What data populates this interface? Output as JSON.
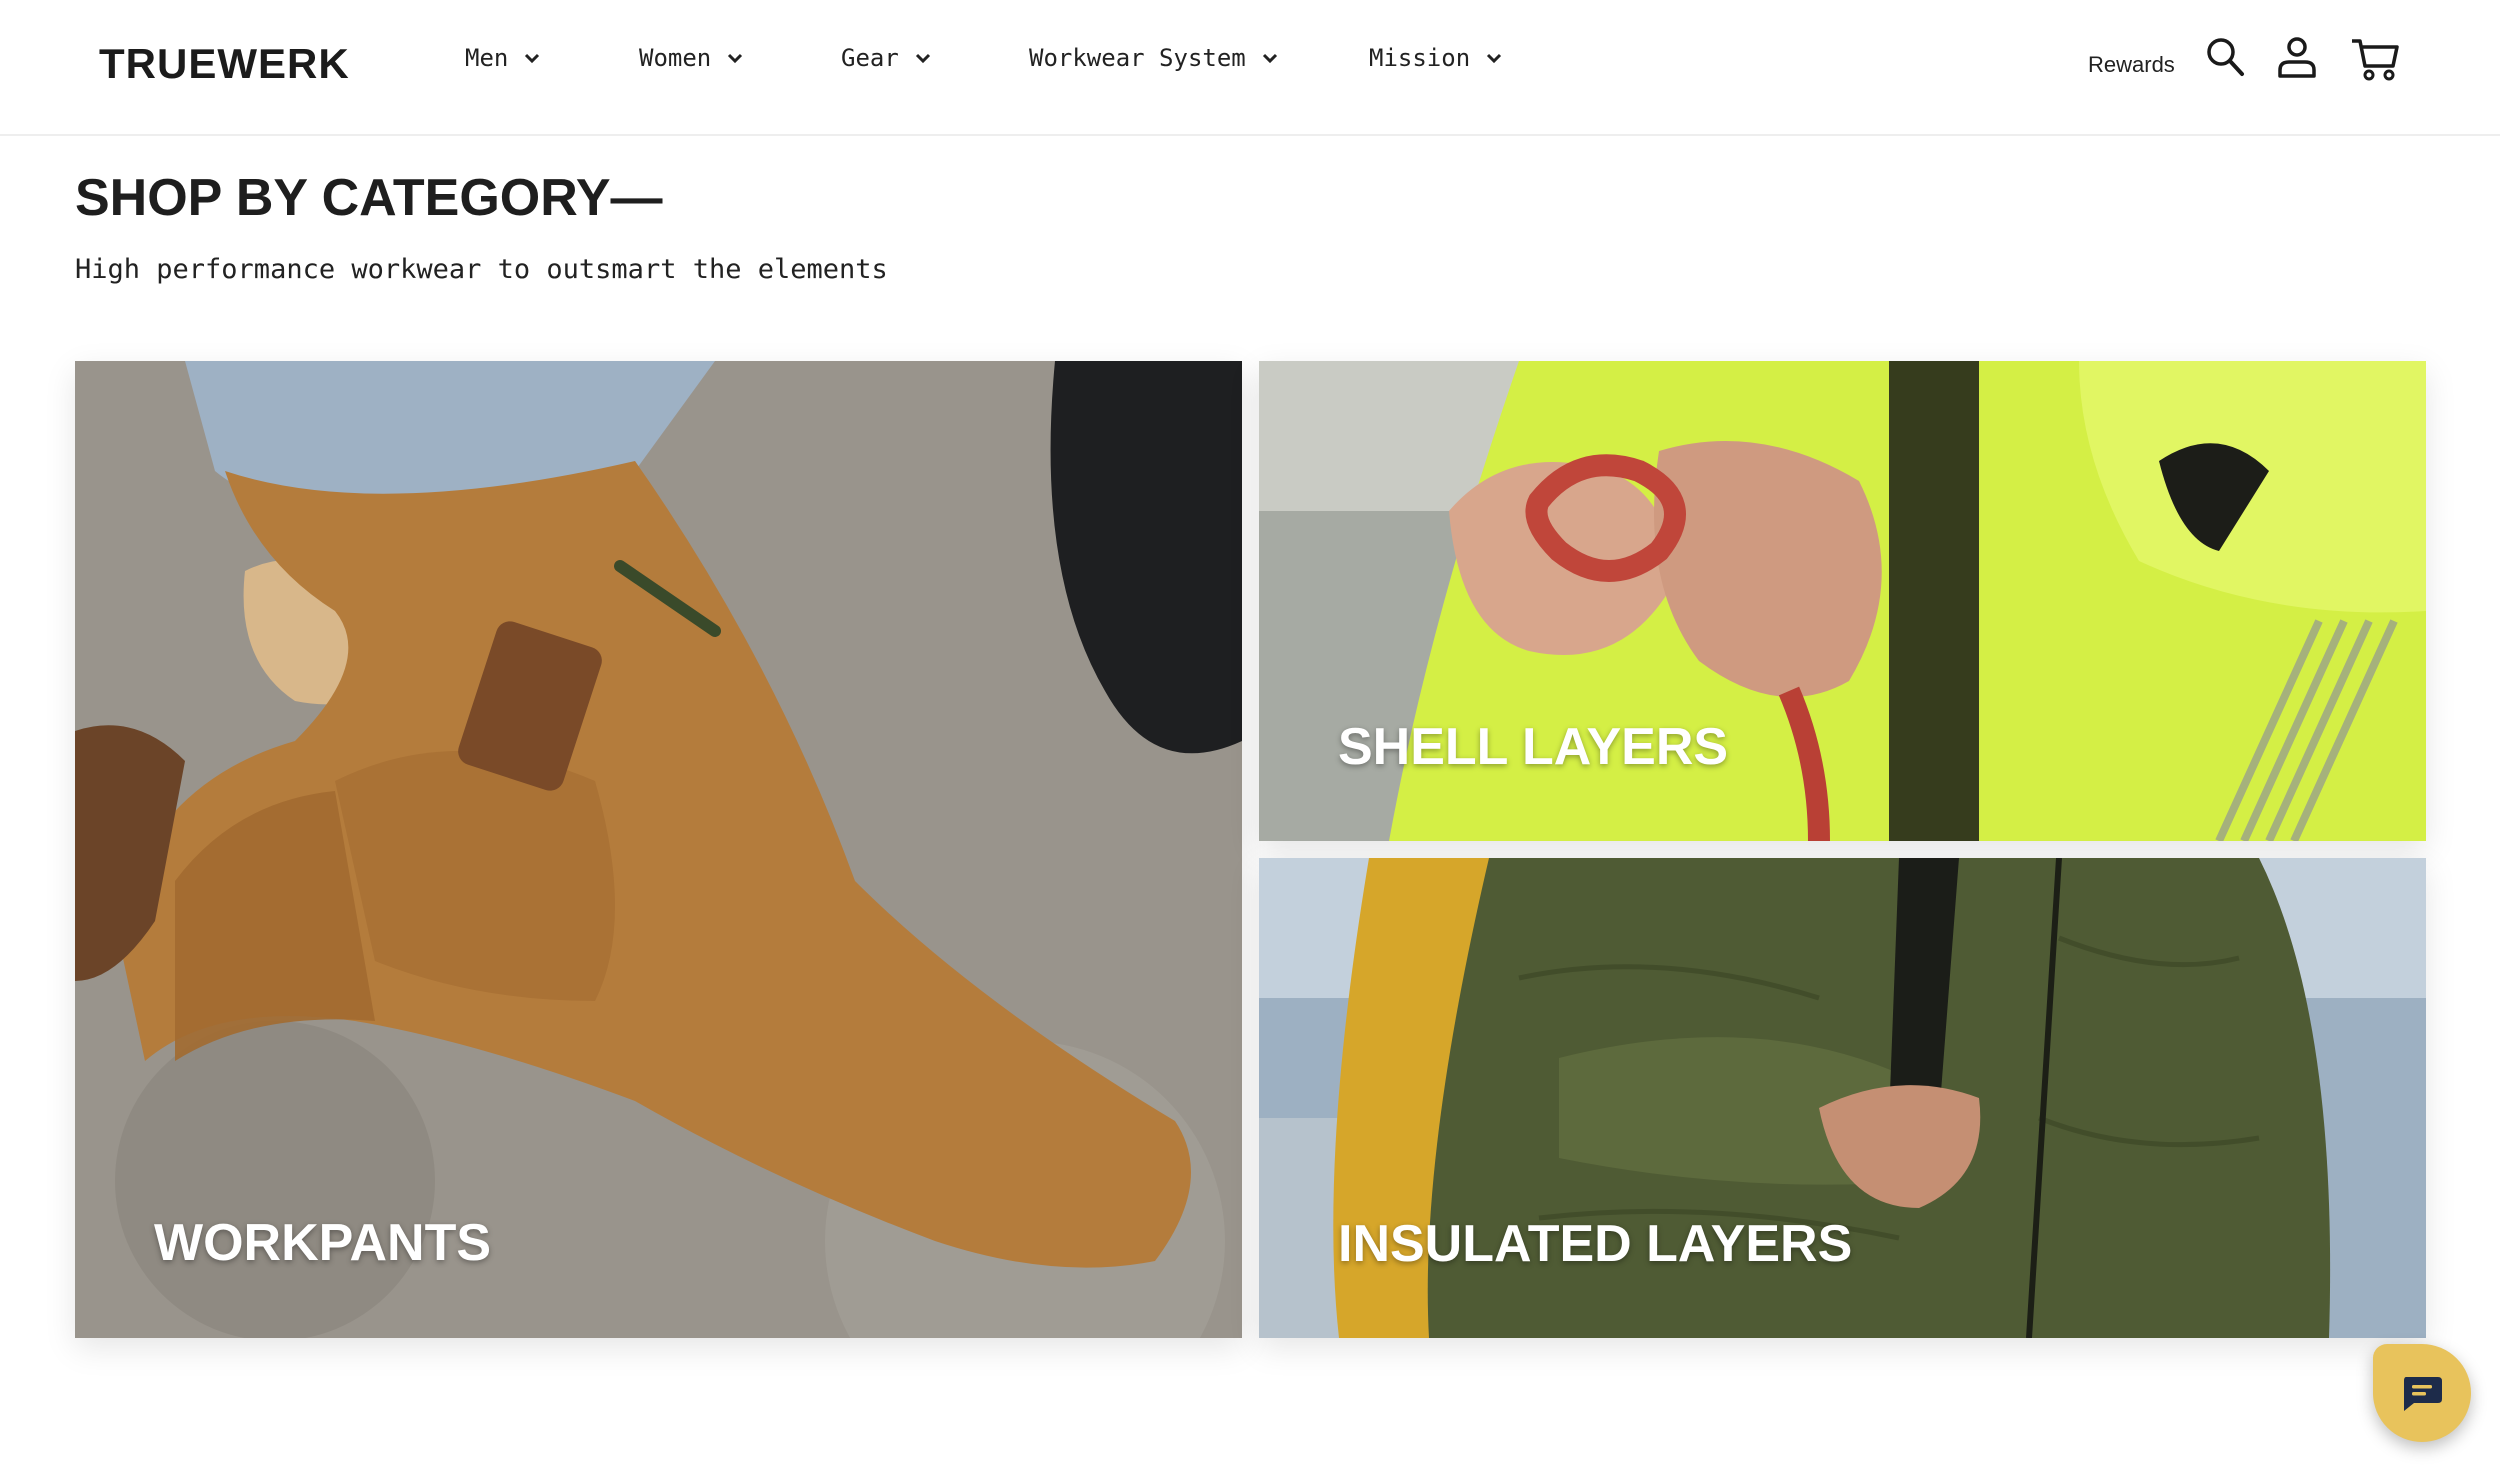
{
  "header": {
    "logo": "TRUEWERK",
    "nav": [
      {
        "label": "Men"
      },
      {
        "label": "Women"
      },
      {
        "label": "Gear"
      },
      {
        "label": "Workwear System"
      },
      {
        "label": "Mission"
      }
    ],
    "rewards_label": "Rewards",
    "icons": [
      "search-icon",
      "account-icon",
      "cart-icon",
      "chevron-down-icon"
    ]
  },
  "main": {
    "title": "SHOP BY CATEGORY—",
    "subtitle": "High performance workwear to outsmart the elements",
    "tiles": [
      {
        "label": "WORKPANTS"
      },
      {
        "label": "SHELL LAYERS"
      },
      {
        "label": "INSULATED LAYERS"
      }
    ]
  },
  "chat": {
    "icon": "chat-icon"
  },
  "colors": {
    "text": "#1a1a1a",
    "pants_tan": "#b07a3a",
    "hivis_yellow": "#d8f24a",
    "jacket_olive": "#4e5a34",
    "chat_button": "#e8c35c"
  }
}
